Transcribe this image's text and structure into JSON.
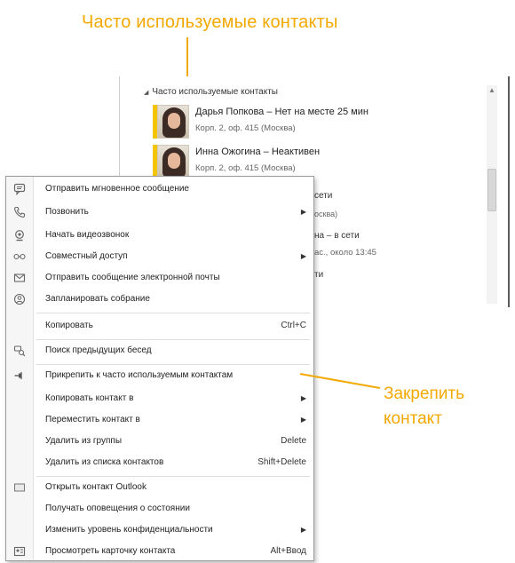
{
  "callouts": {
    "frequent_contacts": "Часто используемые контакты",
    "pin_line1": "Закрепить",
    "pin_line2": "контакт"
  },
  "colors": {
    "accent": "#f2a900",
    "presence": "#f5c400"
  },
  "contacts_panel": {
    "group_header": "Часто используемые контакты",
    "contacts": [
      {
        "name": "Дарья Попкова – Нет на месте 25 мин",
        "location": "Корп. 2, оф. 415 (Москва)"
      },
      {
        "name": "Инна Ожогина – Неактивен",
        "location": "Корп. 2, оф. 415 (Москва)"
      }
    ],
    "partial_texts": [
      "сети",
      "осква)",
      "на – в сети",
      "ас., около 13:45",
      "ти"
    ]
  },
  "context_menu": {
    "items": [
      {
        "label": "Отправить мгновенное сообщение",
        "icon": "chat-icon"
      },
      {
        "label": "Позвонить",
        "icon": "phone-icon",
        "submenu": true
      },
      {
        "label": "Начать видеозвонок",
        "icon": "webcam-icon"
      },
      {
        "label": "Совместный доступ",
        "icon": "share-icon",
        "submenu": true
      },
      {
        "label": "Отправить сообщение электронной почты",
        "icon": "email-icon"
      },
      {
        "label": "Запланировать собрание",
        "icon": "meeting-icon"
      },
      {
        "label": "Копировать",
        "shortcut": "Ctrl+C"
      },
      {
        "label": "Поиск предыдущих бесед",
        "icon": "history-search-icon"
      },
      {
        "label": "Прикрепить к часто используемым контактам",
        "icon": "pin-icon"
      },
      {
        "label": "Копировать контакт в",
        "submenu": true
      },
      {
        "label": "Переместить контакт в",
        "submenu": true
      },
      {
        "label": "Удалить из группы",
        "shortcut": "Delete"
      },
      {
        "label": "Удалить из списка контактов",
        "shortcut": "Shift+Delete"
      },
      {
        "label": "Открыть контакт Outlook",
        "icon": "outlook-contact-icon"
      },
      {
        "label": "Получать оповещения о состоянии"
      },
      {
        "label": "Изменить уровень конфиденциальности",
        "submenu": true
      },
      {
        "label": "Просмотреть карточку контакта",
        "icon": "contact-card-icon",
        "shortcut": "Alt+Ввод"
      }
    ]
  }
}
